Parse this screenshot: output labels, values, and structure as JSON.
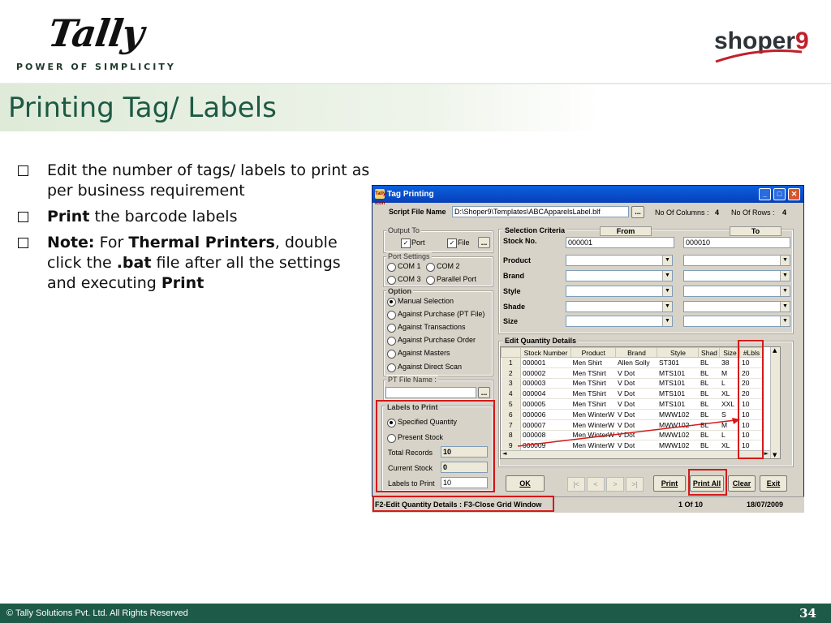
{
  "header": {
    "logo_tally": "Tally",
    "tagline": "POWER OF SIMPLICITY",
    "logo_shoper": "shoper",
    "logo_shoper_nine": "9"
  },
  "slide": {
    "title": "Printing Tag/ Labels",
    "bullet1": "Edit the number of tags/ labels to print as per business requirement",
    "bullet2_bold": "Print",
    "bullet2_rest": " the barcode labels",
    "bullet3_note": "Note:",
    "bullet3_for": " For ",
    "bullet3_thermal": "Thermal Printers",
    "bullet3_mid": ", double click the ",
    "bullet3_bat": ".bat",
    "bullet3_end": " file after all the settings and executing ",
    "bullet3_print": "Print"
  },
  "window": {
    "title": "Tag Printing",
    "title_icon": "Tally-icon",
    "script_label": "Script File Name",
    "script_value": "D:\\Shoper9\\Templates\\ABCApparelsLabel.blf",
    "browse": "...",
    "no_columns_label": "No Of Columns :",
    "no_columns_value": "4",
    "no_rows_label": "No Of Rows :",
    "no_rows_value": "4",
    "output_to": "Output To",
    "port": "Port",
    "file": "File",
    "port_settings": "Port Settings",
    "com1": "COM 1",
    "com2": "COM 2",
    "com3": "COM 3",
    "parallel_port": "Parallel Port",
    "option": "Option",
    "opt_manual": "Manual Selection",
    "opt_purchase_ptfile": "Against Purchase (PT File)",
    "opt_transactions": "Against Transactions",
    "opt_purchase_order": "Against Purchase Order",
    "opt_masters": "Against Masters",
    "opt_scan": "Against Direct Scan",
    "pt_file_name": "PT File Name :",
    "labels_to_print_group": "Labels to Print",
    "specified_quantity": "Specified Quantity",
    "present_stock": "Present Stock",
    "total_records_label": "Total Records",
    "total_records_value": "10",
    "current_stock_label": "Current Stock",
    "current_stock_value": "0",
    "labels_to_print_label": "Labels to Print",
    "labels_to_print_value": "10",
    "selection_criteria": "Selection Criteria",
    "from": "From",
    "to": "To",
    "stock_no": "Stock No.",
    "stock_from": "000001",
    "stock_to": "000010",
    "product": "Product",
    "brand": "Brand",
    "style": "Style",
    "shade": "Shade",
    "size": "Size",
    "edit_qty": "Edit Quantity Details",
    "columns": [
      "Stock Number",
      "Product",
      "Brand",
      "Style",
      "Shad",
      "Size",
      "#Lbls"
    ],
    "rows": [
      [
        "1",
        "000001",
        "Men Shirt",
        "Allen Solly",
        "ST301",
        "BL",
        "38",
        "10"
      ],
      [
        "2",
        "000002",
        "Men TShirt",
        "V Dot",
        "MTS101",
        "BL",
        "M",
        "20"
      ],
      [
        "3",
        "000003",
        "Men TShirt",
        "V Dot",
        "MTS101",
        "BL",
        "L",
        "20"
      ],
      [
        "4",
        "000004",
        "Men TShirt",
        "V Dot",
        "MTS101",
        "BL",
        "XL",
        "20"
      ],
      [
        "5",
        "000005",
        "Men TShirt",
        "V Dot",
        "MTS101",
        "BL",
        "XXL",
        "10"
      ],
      [
        "6",
        "000006",
        "Men WinterW",
        "V Dot",
        "MWW102",
        "BL",
        "S",
        "10"
      ],
      [
        "7",
        "000007",
        "Men WinterW",
        "V Dot",
        "MWW102",
        "BL",
        "M",
        "10"
      ],
      [
        "8",
        "000008",
        "Men WinterW",
        "V Dot",
        "MWW102",
        "BL",
        "L",
        "10"
      ],
      [
        "9",
        "000009",
        "Men WinterW",
        "V Dot",
        "MWW102",
        "BL",
        "XL",
        "10"
      ],
      [
        "10",
        "000010",
        "Men WinterW",
        "V Dot",
        "MWW102",
        "BL",
        "XXL",
        "10"
      ]
    ],
    "btn_ok": "OK",
    "nav_first": "|<",
    "nav_prev": "<",
    "nav_next": ">",
    "nav_last": ">|",
    "btn_print": "Print",
    "btn_print_all": "Print All",
    "btn_clear": "Clear",
    "btn_exit": "Exit",
    "status_left": "F2-Edit Quantity Details : F3-Close Grid Window",
    "status_page": "1 Of 10",
    "status_date": "18/07/2009"
  },
  "footer": {
    "copyright": "© Tally Solutions Pvt. Ltd. All Rights Reserved",
    "page": "34"
  },
  "colors": {
    "title_green": "#1d5a45",
    "footer_green": "#1e5a48",
    "highlight_red": "#d41a1a",
    "titlebar_blue": "#0a5fe0"
  }
}
